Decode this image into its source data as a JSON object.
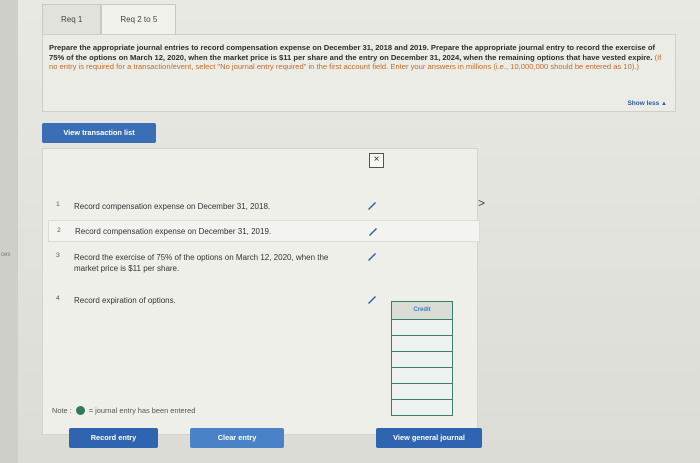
{
  "left_edge": {
    "label": "ces"
  },
  "tabs": [
    {
      "label": "Req 1",
      "active": false
    },
    {
      "label": "Req 2 to 5",
      "active": true
    }
  ],
  "instructions": {
    "main": "Prepare the appropriate journal entries to record compensation expense on December 31, 2018 and 2019. Prepare the appropriate journal entry to record the exercise of 75% of the options on March 12, 2020, when the market price is $11 per share and the entry on December 31, 2024, when the remaining options that have vested expire.",
    "note": "(If no entry is required for a transaction/event, select \"No journal entry required\" in the first account field. Enter your answers in millions (i.e., 10,000,000 should be entered as 10).)",
    "show_less": "Show less"
  },
  "view_list_button": "View transaction list",
  "close_mark": "×",
  "items": [
    {
      "num": "1",
      "text": "Record compensation expense on December 31, 2018."
    },
    {
      "num": "2",
      "text": "Record compensation expense on December 31, 2019."
    },
    {
      "num": "3",
      "text": "Record the exercise of 75% of the options on March 12, 2020, when the market price is $11 per share."
    },
    {
      "num": "4",
      "text": "Record expiration of options."
    }
  ],
  "chevron": ">",
  "credit_header": "Credit",
  "note": {
    "label": "Note :",
    "text": "= journal entry has been entered"
  },
  "buttons": {
    "record": "Record entry",
    "clear": "Clear entry",
    "view_general": "View general journal"
  }
}
